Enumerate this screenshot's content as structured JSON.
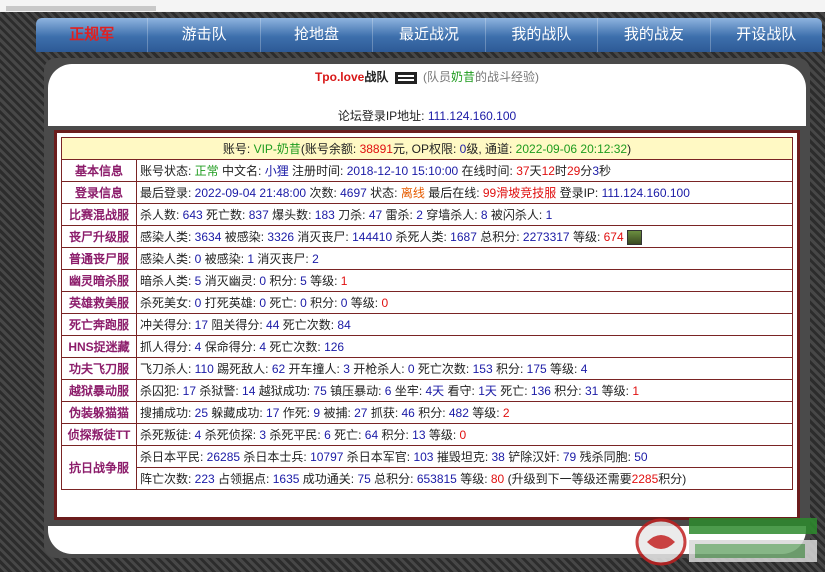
{
  "nav": {
    "items": [
      "正规军",
      "游击队",
      "抢地盘",
      "最近战况",
      "我的战队",
      "我的战友",
      "开设战队"
    ]
  },
  "header": {
    "team_name": "Tpo.love",
    "team_suffix": "战队",
    "member_prefix": "(队员",
    "member_name": "奶昔",
    "member_suffix": "的战斗经验)"
  },
  "ip_line": {
    "label": "论坛登录IP地址:",
    "value": "111.124.160.100"
  },
  "account": {
    "p1": "账号: ",
    "account": "VIP-奶昔",
    "p2": "(账号余额: ",
    "balance": "38891",
    "p3": "元, OP权限: ",
    "op": "0",
    "p4": "级, 通道: ",
    "channel": "2022-09-06 20:12:32",
    "p5": ")"
  },
  "colors": {
    "label": "#8c1d6b",
    "blue": "#1a1aa6",
    "green": "#1f9c1f",
    "red": "#e01010",
    "orange": "#e65c00",
    "border": "#7a2424"
  },
  "rows": [
    {
      "label": "基本信息",
      "parts": [
        {
          "t": "账号状态: "
        },
        {
          "t": "正常",
          "c": "green"
        },
        {
          "t": " 中文名: "
        },
        {
          "t": "小狸",
          "c": "blue"
        },
        {
          "t": " 注册时间: "
        },
        {
          "t": "2018-12-10 15:10:00",
          "c": "blue"
        },
        {
          "t": " 在线时间: "
        },
        {
          "t": "37",
          "c": "red"
        },
        {
          "t": "天"
        },
        {
          "t": "12",
          "c": "red"
        },
        {
          "t": "时"
        },
        {
          "t": "29",
          "c": "red"
        },
        {
          "t": "分"
        },
        {
          "t": "3",
          "c": "blue"
        },
        {
          "t": "秒"
        }
      ]
    },
    {
      "label": "登录信息",
      "parts": [
        {
          "t": "最后登录: "
        },
        {
          "t": "2022-09-04 21:48:00",
          "c": "blue"
        },
        {
          "t": " 次数: "
        },
        {
          "t": "4697",
          "c": "blue"
        },
        {
          "t": " 状态: "
        },
        {
          "t": "离线",
          "c": "orange"
        },
        {
          "t": " 最后在线: "
        },
        {
          "t": "99滑坡竞技服",
          "c": "red"
        },
        {
          "t": " 登录IP: "
        },
        {
          "t": "111.124.160.100",
          "c": "blue"
        }
      ]
    },
    {
      "label": "比赛混战服",
      "parts": [
        {
          "t": "杀人数: "
        },
        {
          "t": "643",
          "c": "blue"
        },
        {
          "t": " 死亡数: "
        },
        {
          "t": "837",
          "c": "blue"
        },
        {
          "t": " 爆头数: "
        },
        {
          "t": "183",
          "c": "blue"
        },
        {
          "t": " 刀杀: "
        },
        {
          "t": "47",
          "c": "blue"
        },
        {
          "t": " 雷杀: "
        },
        {
          "t": "2",
          "c": "blue"
        },
        {
          "t": " 穿墙杀人: "
        },
        {
          "t": "8",
          "c": "blue"
        },
        {
          "t": " 被闪杀人: "
        },
        {
          "t": "1",
          "c": "blue"
        }
      ]
    },
    {
      "label": "丧尸升级服",
      "zombie": true,
      "parts": [
        {
          "t": "感染人类: "
        },
        {
          "t": "3634",
          "c": "blue"
        },
        {
          "t": " 被感染: "
        },
        {
          "t": "3326",
          "c": "blue"
        },
        {
          "t": " 消灭丧尸: "
        },
        {
          "t": "144410",
          "c": "blue"
        },
        {
          "t": " 杀死人类: "
        },
        {
          "t": "1687",
          "c": "blue"
        },
        {
          "t": " 总积分: "
        },
        {
          "t": "2273317",
          "c": "blue"
        },
        {
          "t": " 等级: "
        },
        {
          "t": "674",
          "c": "red"
        }
      ]
    },
    {
      "label": "普通丧尸服",
      "parts": [
        {
          "t": "感染人类: "
        },
        {
          "t": "0",
          "c": "blue"
        },
        {
          "t": " 被感染: "
        },
        {
          "t": "1",
          "c": "blue"
        },
        {
          "t": " 消灭丧尸: "
        },
        {
          "t": "2",
          "c": "blue"
        }
      ]
    },
    {
      "label": "幽灵暗杀服",
      "parts": [
        {
          "t": "暗杀人类: "
        },
        {
          "t": "5",
          "c": "blue"
        },
        {
          "t": " 消灭幽灵: "
        },
        {
          "t": "0",
          "c": "blue"
        },
        {
          "t": " 积分: "
        },
        {
          "t": "5",
          "c": "blue"
        },
        {
          "t": " 等级: "
        },
        {
          "t": "1",
          "c": "red"
        }
      ]
    },
    {
      "label": "英雄救美服",
      "parts": [
        {
          "t": "杀死美女: "
        },
        {
          "t": "0",
          "c": "blue"
        },
        {
          "t": " 打死英雄: "
        },
        {
          "t": "0",
          "c": "blue"
        },
        {
          "t": " 死亡: "
        },
        {
          "t": "0",
          "c": "blue"
        },
        {
          "t": " 积分: "
        },
        {
          "t": "0",
          "c": "blue"
        },
        {
          "t": " 等级: "
        },
        {
          "t": "0",
          "c": "red"
        }
      ]
    },
    {
      "label": "死亡奔跑服",
      "parts": [
        {
          "t": "冲关得分: "
        },
        {
          "t": "17",
          "c": "blue"
        },
        {
          "t": " 阻关得分: "
        },
        {
          "t": "44",
          "c": "blue"
        },
        {
          "t": " 死亡次数: "
        },
        {
          "t": "84",
          "c": "blue"
        }
      ]
    },
    {
      "label": "HNS捉迷藏",
      "parts": [
        {
          "t": "抓人得分: "
        },
        {
          "t": "4",
          "c": "blue"
        },
        {
          "t": " 保命得分: "
        },
        {
          "t": "4",
          "c": "blue"
        },
        {
          "t": " 死亡次数: "
        },
        {
          "t": "126",
          "c": "blue"
        }
      ]
    },
    {
      "label": "功夫飞刀服",
      "parts": [
        {
          "t": "飞刀杀人: "
        },
        {
          "t": "110",
          "c": "blue"
        },
        {
          "t": " 踢死敌人: "
        },
        {
          "t": "62",
          "c": "blue"
        },
        {
          "t": " 开车撞人: "
        },
        {
          "t": "3",
          "c": "blue"
        },
        {
          "t": " 开枪杀人: "
        },
        {
          "t": "0",
          "c": "blue"
        },
        {
          "t": " 死亡次数: "
        },
        {
          "t": "153",
          "c": "blue"
        },
        {
          "t": " 积分: "
        },
        {
          "t": "175",
          "c": "blue"
        },
        {
          "t": " 等级: "
        },
        {
          "t": "4",
          "c": "blue"
        }
      ]
    },
    {
      "label": "越狱暴动服",
      "parts": [
        {
          "t": "杀囚犯: "
        },
        {
          "t": "17",
          "c": "blue"
        },
        {
          "t": " 杀狱警: "
        },
        {
          "t": "14",
          "c": "blue"
        },
        {
          "t": " 越狱成功: "
        },
        {
          "t": "75",
          "c": "blue"
        },
        {
          "t": " 镇压暴动: "
        },
        {
          "t": "6",
          "c": "blue"
        },
        {
          "t": " 坐牢: "
        },
        {
          "t": "4天",
          "c": "blue"
        },
        {
          "t": " 看守: "
        },
        {
          "t": "1天",
          "c": "blue"
        },
        {
          "t": " 死亡: "
        },
        {
          "t": "136",
          "c": "blue"
        },
        {
          "t": " 积分: "
        },
        {
          "t": "31",
          "c": "blue"
        },
        {
          "t": " 等级: "
        },
        {
          "t": "1",
          "c": "red"
        }
      ]
    },
    {
      "label": "伪装躲猫猫",
      "parts": [
        {
          "t": "搜捕成功: "
        },
        {
          "t": "25",
          "c": "blue"
        },
        {
          "t": " 躲藏成功: "
        },
        {
          "t": "17",
          "c": "blue"
        },
        {
          "t": " 作死: "
        },
        {
          "t": "9",
          "c": "blue"
        },
        {
          "t": " 被捕: "
        },
        {
          "t": "27",
          "c": "blue"
        },
        {
          "t": " 抓获: "
        },
        {
          "t": "46",
          "c": "blue"
        },
        {
          "t": " 积分: "
        },
        {
          "t": "482",
          "c": "blue"
        },
        {
          "t": " 等级: "
        },
        {
          "t": "2",
          "c": "red"
        }
      ]
    },
    {
      "label": "侦探叛徒TT",
      "parts": [
        {
          "t": "杀死叛徒: "
        },
        {
          "t": "4",
          "c": "blue"
        },
        {
          "t": " 杀死侦探: "
        },
        {
          "t": "3",
          "c": "blue"
        },
        {
          "t": " 杀死平民: "
        },
        {
          "t": "6",
          "c": "blue"
        },
        {
          "t": " 死亡: "
        },
        {
          "t": "64",
          "c": "blue"
        },
        {
          "t": " 积分: "
        },
        {
          "t": "13",
          "c": "blue"
        },
        {
          "t": " 等级: "
        },
        {
          "t": "0",
          "c": "red"
        }
      ]
    }
  ],
  "war_row": {
    "label": "抗日战争服",
    "line1": [
      {
        "t": "杀日本平民: "
      },
      {
        "t": "26285",
        "c": "blue"
      },
      {
        "t": " 杀日本士兵: "
      },
      {
        "t": "10797",
        "c": "blue"
      },
      {
        "t": " 杀日本军官: "
      },
      {
        "t": "103",
        "c": "blue"
      },
      {
        "t": " 摧毁坦克: "
      },
      {
        "t": "38",
        "c": "blue"
      },
      {
        "t": " 铲除汉奸: "
      },
      {
        "t": "79",
        "c": "blue"
      },
      {
        "t": " 残杀同胞: "
      },
      {
        "t": "50",
        "c": "blue"
      }
    ],
    "line2": [
      {
        "t": "阵亡次数: "
      },
      {
        "t": "223",
        "c": "blue"
      },
      {
        "t": " 占领据点: "
      },
      {
        "t": "1635",
        "c": "blue"
      },
      {
        "t": " 成功通关: "
      },
      {
        "t": "75",
        "c": "blue"
      },
      {
        "t": " 总积分: "
      },
      {
        "t": "653815",
        "c": "blue"
      },
      {
        "t": " 等级: "
      },
      {
        "t": "80",
        "c": "red"
      },
      {
        "t": " (升级到下一等级还需要"
      },
      {
        "t": "2285",
        "c": "red"
      },
      {
        "t": "积分)"
      }
    ]
  }
}
